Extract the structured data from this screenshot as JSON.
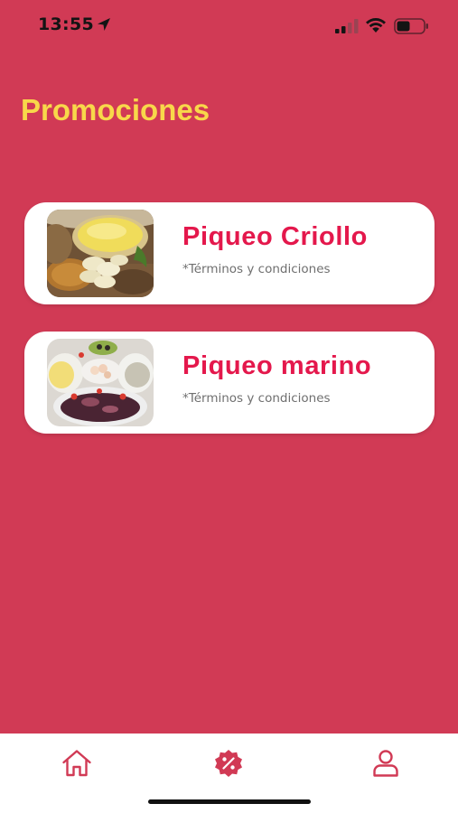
{
  "status_bar": {
    "time": "13:55",
    "icons": [
      "location-arrow-icon",
      "cellular-signal-icon",
      "wifi-icon",
      "battery-icon"
    ]
  },
  "page": {
    "title": "Promociones"
  },
  "promotions": [
    {
      "title": "Piqueo Criollo",
      "terms": "*Términos y condiciones",
      "image": "piqueo-criollo-photo"
    },
    {
      "title": "Piqueo marino",
      "terms": "*Términos y condiciones",
      "image": "piqueo-marino-photo"
    }
  ],
  "tab_bar": {
    "tabs": [
      {
        "icon": "home-icon",
        "active": false
      },
      {
        "icon": "discount-badge-icon",
        "active": true
      },
      {
        "icon": "profile-icon",
        "active": false
      }
    ]
  },
  "colors": {
    "background": "#d13a55",
    "title": "#f8d84a",
    "card_title": "#e4184c",
    "tab_icon": "#d13a55"
  }
}
